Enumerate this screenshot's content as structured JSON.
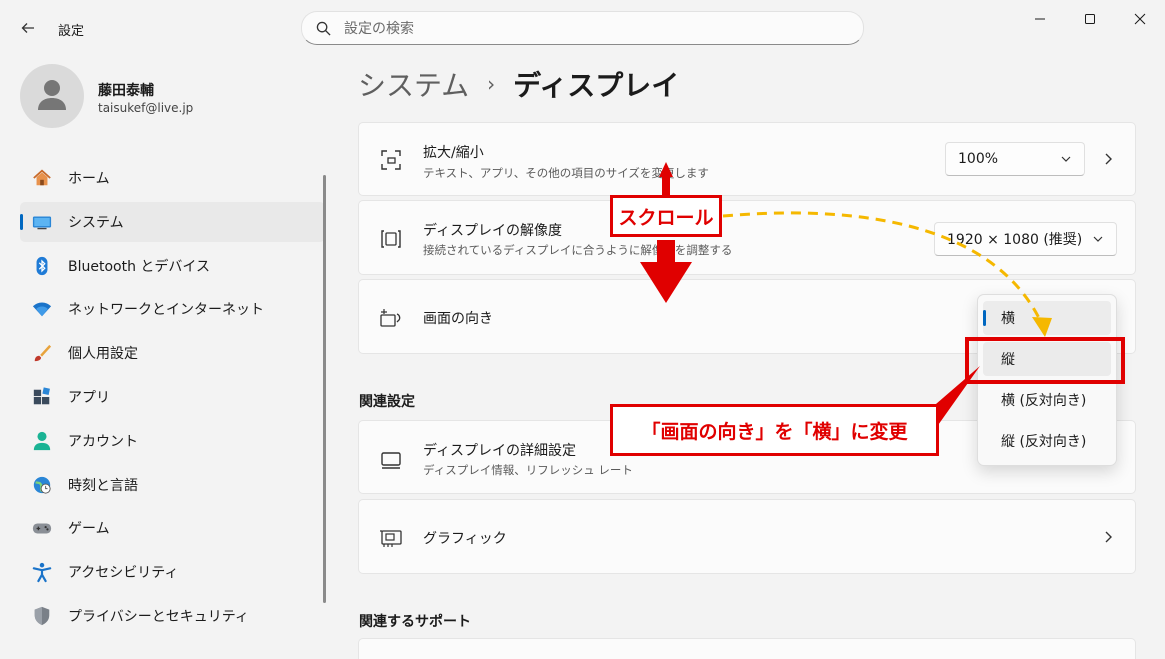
{
  "window": {
    "app_title": "設定",
    "search_placeholder": "設定の検索"
  },
  "user": {
    "name": "藤田泰輔",
    "email": "taisukef@live.jp"
  },
  "sidebar": {
    "items": [
      {
        "label": "ホーム",
        "icon": "home-icon"
      },
      {
        "label": "システム",
        "icon": "system-icon",
        "selected": true
      },
      {
        "label": "Bluetooth とデバイス",
        "icon": "bluetooth-icon"
      },
      {
        "label": "ネットワークとインターネット",
        "icon": "wifi-icon"
      },
      {
        "label": "個人用設定",
        "icon": "brush-icon"
      },
      {
        "label": "アプリ",
        "icon": "apps-icon"
      },
      {
        "label": "アカウント",
        "icon": "account-icon"
      },
      {
        "label": "時刻と言語",
        "icon": "globe-clock-icon"
      },
      {
        "label": "ゲーム",
        "icon": "gamepad-icon"
      },
      {
        "label": "アクセシビリティ",
        "icon": "accessibility-icon"
      },
      {
        "label": "プライバシーとセキュリティ",
        "icon": "shield-icon"
      }
    ]
  },
  "breadcrumb": {
    "parent": "システム",
    "separator": "›",
    "current": "ディスプレイ"
  },
  "settings": {
    "scale": {
      "title": "拡大/縮小",
      "subtitle": "テキスト、アプリ、その他の項目のサイズを変更します",
      "value": "100%"
    },
    "resolution": {
      "title": "ディスプレイの解像度",
      "subtitle": "接続されているディスプレイに合うように解像度を調整する",
      "value": "1920 × 1080 (推奨)"
    },
    "orientation": {
      "title": "画面の向き"
    }
  },
  "related": {
    "section_title": "関連設定",
    "advanced": {
      "title": "ディスプレイの詳細設定",
      "subtitle": "ディスプレイ情報、リフレッシュ レート"
    },
    "graphics": {
      "title": "グラフィック"
    }
  },
  "support": {
    "section_title": "関連するサポート"
  },
  "orientation_dropdown": {
    "options": [
      "横",
      "縦",
      "横 (反対向き)",
      "縦 (反対向き)"
    ],
    "selected": "横",
    "highlighted": "縦"
  },
  "annotations": {
    "scroll_label": "スクロール",
    "instruction": "「画面の向き」を「横」に変更",
    "accent_color": "#e00000",
    "arrow_color": "#f5b800"
  }
}
